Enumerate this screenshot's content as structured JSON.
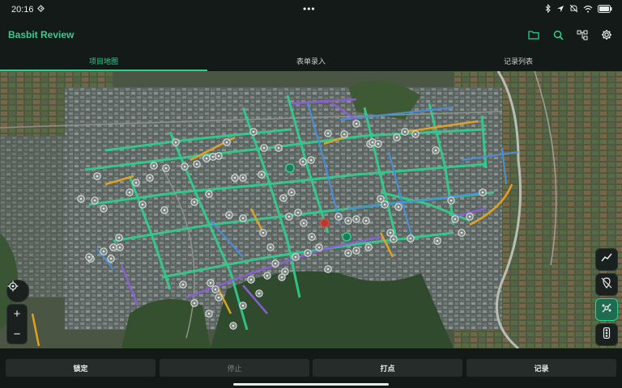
{
  "status": {
    "time": "20:16",
    "more": "•••"
  },
  "app": {
    "title": "Basbit Review"
  },
  "tabs": [
    {
      "label": "项目地图",
      "active": true
    },
    {
      "label": "表单录入",
      "active": false
    },
    {
      "label": "记录列表",
      "active": false
    }
  ],
  "map_controls": {
    "zoom_in": "+",
    "zoom_out": "−"
  },
  "bottom_buttons": [
    {
      "label": "锁定",
      "disabled": false
    },
    {
      "label": "停止",
      "disabled": true
    },
    {
      "label": "打点",
      "disabled": false
    },
    {
      "label": "记录",
      "disabled": false
    }
  ],
  "colors": {
    "accent": "#2fd08f",
    "road_green": "#2fd08f",
    "road_blue": "#4a8fd8",
    "road_purple": "#8c5fd6",
    "road_orange": "#e6a521",
    "marker_red": "#e0443c"
  },
  "icons": [
    "folder-icon",
    "search-icon",
    "network-icon",
    "gear-icon",
    "chart-icon",
    "location-off-icon",
    "route-icon",
    "traffic-light-icon",
    "locate-icon"
  ]
}
